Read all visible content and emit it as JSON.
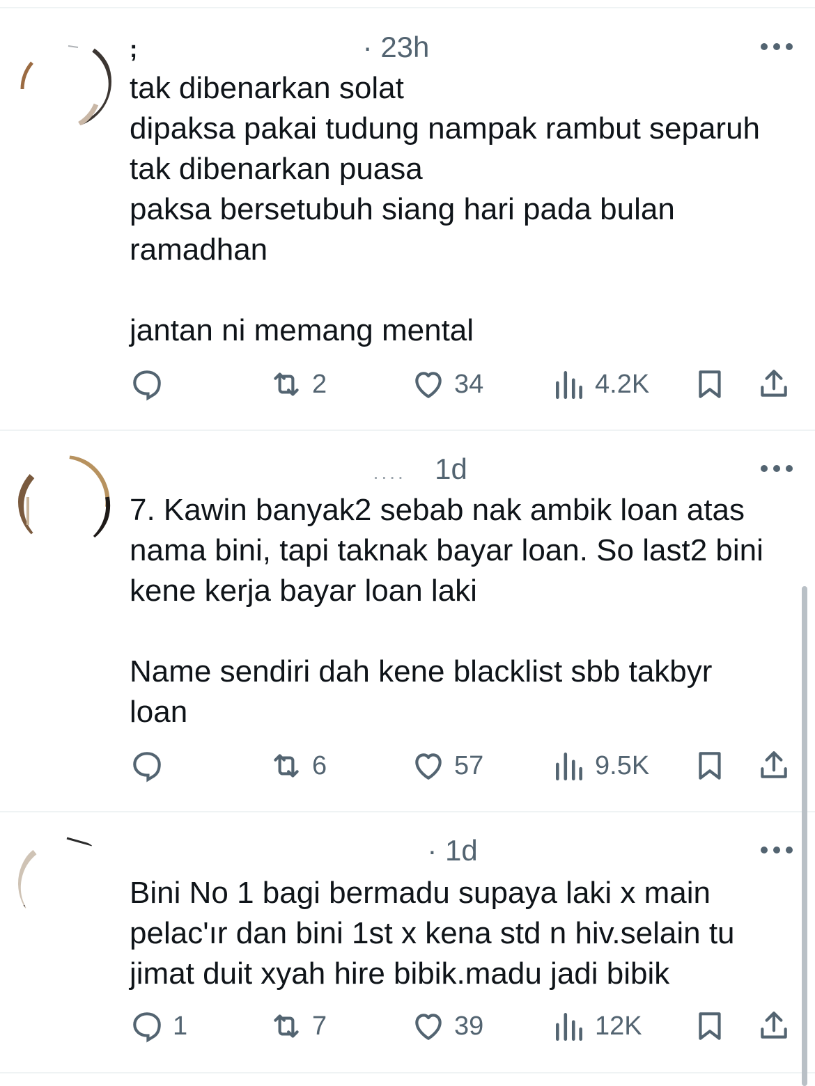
{
  "tweets": [
    {
      "author_name": ";",
      "time": "· 23h",
      "text": "tak dibenarkan solat\ndipaksa pakai tudung nampak rambut separuh\ntak dibenarkan puasa\npaksa bersetubuh siang hari pada bulan\nramadhan\n\njantan ni memang mental",
      "replies": "",
      "retweets": "2",
      "likes": "34",
      "views": "4.2K"
    },
    {
      "author_name": "....",
      "time": "1d",
      "text": "7. Kawin banyak2 sebab nak ambik loan atas\nnama bini, tapi taknak bayar loan. So last2 bini\nkene kerja bayar loan laki\n\nName sendiri dah kene blacklist sbb takbyr\nloan",
      "replies": "",
      "retweets": "6",
      "likes": "57",
      "views": "9.5K"
    },
    {
      "author_name": "",
      "time": "· 1d",
      "text": "Bini No 1 bagi bermadu supaya laki x main\npelacʹır dan bini 1st x kena std n hiv.selain tu\njimat duit xyah hire bibik.madu jadi bibik",
      "replies": "1",
      "retweets": "7",
      "likes": "39",
      "views": "12K"
    }
  ],
  "icons": {
    "reply": "reply-icon",
    "retweet": "retweet-icon",
    "like": "heart-icon",
    "views": "views-chart-icon",
    "bookmark": "bookmark-icon",
    "share": "share-icon",
    "more": "more-dots-icon"
  },
  "colors": {
    "text": "#0f1419",
    "secondary": "#536471",
    "divider": "#eff3f4"
  }
}
